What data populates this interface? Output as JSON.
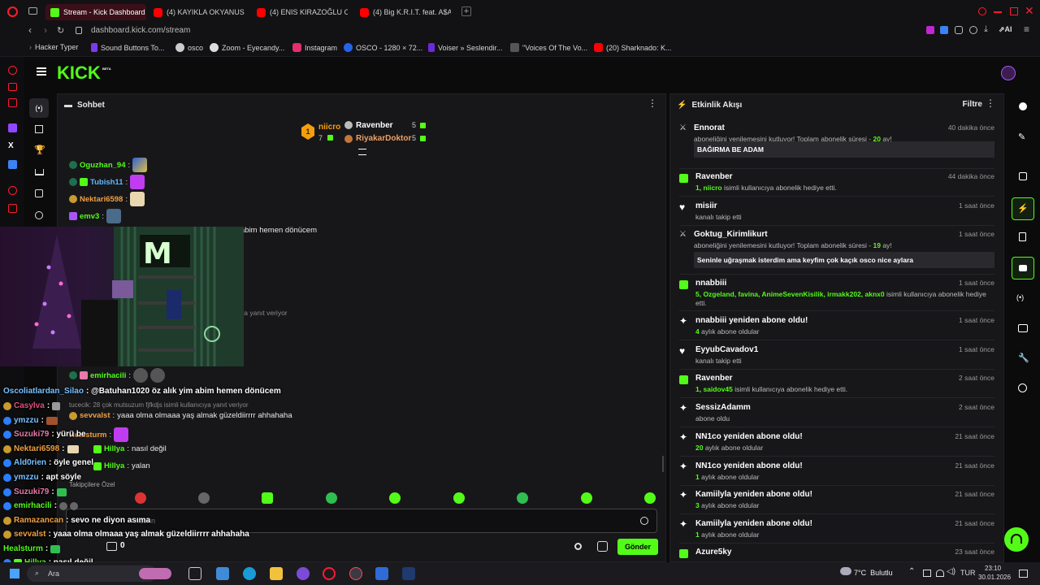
{
  "tabs": [
    {
      "label": "Stream - Kick Dashboard",
      "active": true
    },
    {
      "label": "(4) KAYIKLA OKYANUSU ...",
      "active": false
    },
    {
      "label": "(4) ENIS KIRAZOĞLU OYU...",
      "active": false
    },
    {
      "label": "(4) Big K.R.I.T. feat. A$AP ...",
      "active": false
    }
  ],
  "address": {
    "url": "dashboard.kick.com/stream"
  },
  "bookmarks": [
    "Hacker Typer",
    "Sound Buttons To...",
    "osco",
    "Zoom - Eyecandy...",
    "Instagram",
    "OSCO - 1280 × 72...",
    "Voiser » Seslendir...",
    "\"Voices Of The Vo...",
    "(20) Sharknado: K..."
  ],
  "kick": {
    "logo": "KICK",
    "logo_sup": "BETA"
  },
  "chat": {
    "title": "Sohbet",
    "leaderboard": {
      "first_rank": "1",
      "first_name": "niicro",
      "first_count": "7",
      "second_name": "Ravenber",
      "second_count": "5",
      "third_name": "RiyakarDoktor",
      "third_count": "5"
    },
    "messages": [
      {
        "user": "Oguzhan_94",
        "text": ":"
      },
      {
        "user": "Tubish11",
        "text": ":"
      },
      {
        "user": "Nektari6598",
        "text": ":"
      },
      {
        "user": "emv3",
        "text": ":"
      },
      {
        "user": "",
        "text": "abim hemen dönücem"
      },
      {
        "user": "",
        "text": "ya yanıt veriyor"
      },
      {
        "user": "emirhacili",
        "text": ":"
      },
      {
        "user": "",
        "text": "tucecik: 28 çok mutsuzum fjfkdjs isimli kullanıcıya yanıt veriyor"
      },
      {
        "user": "sevvalst",
        "text": "yaaa olma olmaaa yaş almak güzeldiirrrr ahhahaha"
      },
      {
        "user": "Healsturm",
        "text": ":"
      },
      {
        "user": "Hillya",
        "text": "nasıl değil"
      },
      {
        "user": "Hillya",
        "text": "yalan"
      }
    ],
    "emote_label": "Takipçilere Özel",
    "input_placeholder": "nderin",
    "points": "0",
    "send_label": "Gönder"
  },
  "overlay_chat": [
    {
      "user": "Oscoliatlardan_Silao",
      "text": ": @Batuhan1020 öz alık yim abim hemen dönücem"
    },
    {
      "user": "Casylva",
      "text": ":"
    },
    {
      "user": "ymzzu",
      "text": ":"
    },
    {
      "user": "Suzuki79",
      "text": ": yürü be"
    },
    {
      "user": "Nektari6598",
      "text": ":"
    },
    {
      "user": "Ald0rien",
      "text": ": öyle genel"
    },
    {
      "user": "ymzzu",
      "text": ": apt söyle"
    },
    {
      "user": "Suzuki79",
      "text": ":"
    },
    {
      "user": "emirhacili",
      "text": ":"
    },
    {
      "user": "Ramazancan",
      "text": ": sevo ne diyon asıma"
    },
    {
      "user": "sevvalst",
      "text": ": yaaa olma olmaaa yaş almak güzeldiirrrr ahhahaha"
    },
    {
      "user": "Healsturm",
      "text": ":"
    },
    {
      "user": "Hillya",
      "text": ": nasıl değil"
    },
    {
      "user": "Hillya",
      "text": ": yalan"
    }
  ],
  "activity": {
    "title": "Etkinlik Akışı",
    "filter_label": "Filtre",
    "events": [
      {
        "name": "Ennorat",
        "time": "40 dakika önce",
        "desc_pre": "aboneliğini yenilemesini kutluyor! Toplam abonelik süresi - ",
        "desc_hl": "20",
        "desc_post": " ay!",
        "msg": "BAĞIRMA BE ADAM"
      },
      {
        "name": "Ravenber",
        "time": "44 dakika önce",
        "desc_pre": "",
        "desc_hl": "1, niicro",
        "desc_post": " isimli kullanıcıya abonelik hediye etti."
      },
      {
        "name": "misiir",
        "time": "1 saat önce",
        "desc_pre": "kanalı takip etti",
        "desc_hl": "",
        "desc_post": ""
      },
      {
        "name": "Goktug_Kirimlikurt",
        "time": "1 saat önce",
        "desc_pre": "aboneliğini yenilemesini kutluyor! Toplam abonelik süresi - ",
        "desc_hl": "19",
        "desc_post": " ay!",
        "msg": "Seninle uğraşmak isterdim ama keyfim çok kaçık osco nice aylara"
      },
      {
        "name": "nnabbiii",
        "time": "1 saat önce",
        "desc_pre": "",
        "desc_hl": "5, Ozgeland, favina, AnimeSevenKisilik, irmakk202, aknx0",
        "desc_post": " isimli kullanıcıya abonelik hediye etti."
      },
      {
        "name": "nnabbiii yeniden abone oldu!",
        "time": "1 saat önce",
        "desc_pre": "",
        "desc_hl": "4",
        "desc_post": " aylık abone oldular"
      },
      {
        "name": "EyyubCavadov1",
        "time": "1 saat önce",
        "desc_pre": "kanalı takip etti",
        "desc_hl": "",
        "desc_post": ""
      },
      {
        "name": "Ravenber",
        "time": "2 saat önce",
        "desc_pre": "",
        "desc_hl": "1, saidov45",
        "desc_post": " isimli kullanıcıya abonelik hediye etti."
      },
      {
        "name": "SessizAdamm",
        "time": "2 saat önce",
        "desc_pre": "abone oldu",
        "desc_hl": "",
        "desc_post": ""
      },
      {
        "name": "NN1co yeniden abone oldu!",
        "time": "21 saat önce",
        "desc_pre": "",
        "desc_hl": "20",
        "desc_post": " aylık abone oldular"
      },
      {
        "name": "NN1co yeniden abone oldu!",
        "time": "21 saat önce",
        "desc_pre": "",
        "desc_hl": "1",
        "desc_post": " aylık abone oldular"
      },
      {
        "name": "Kamiilyla yeniden abone oldu!",
        "time": "21 saat önce",
        "desc_pre": "",
        "desc_hl": "3",
        "desc_post": " aylık abone oldular"
      },
      {
        "name": "Kamiilyla yeniden abone oldu!",
        "time": "21 saat önce",
        "desc_pre": "",
        "desc_hl": "1",
        "desc_post": " aylık abone oldular"
      },
      {
        "name": "Azure5ky",
        "time": "23 saat önce",
        "desc_pre": "",
        "desc_hl": "",
        "desc_post": ""
      }
    ]
  },
  "taskbar": {
    "search": "Ara",
    "weather": "7°C  Bulutlu",
    "lang": "TUR",
    "time": "23:10",
    "date": "30.01.2026"
  },
  "colors": {
    "kick_green": "#53fc18",
    "opera_red": "#ff1b2d"
  }
}
